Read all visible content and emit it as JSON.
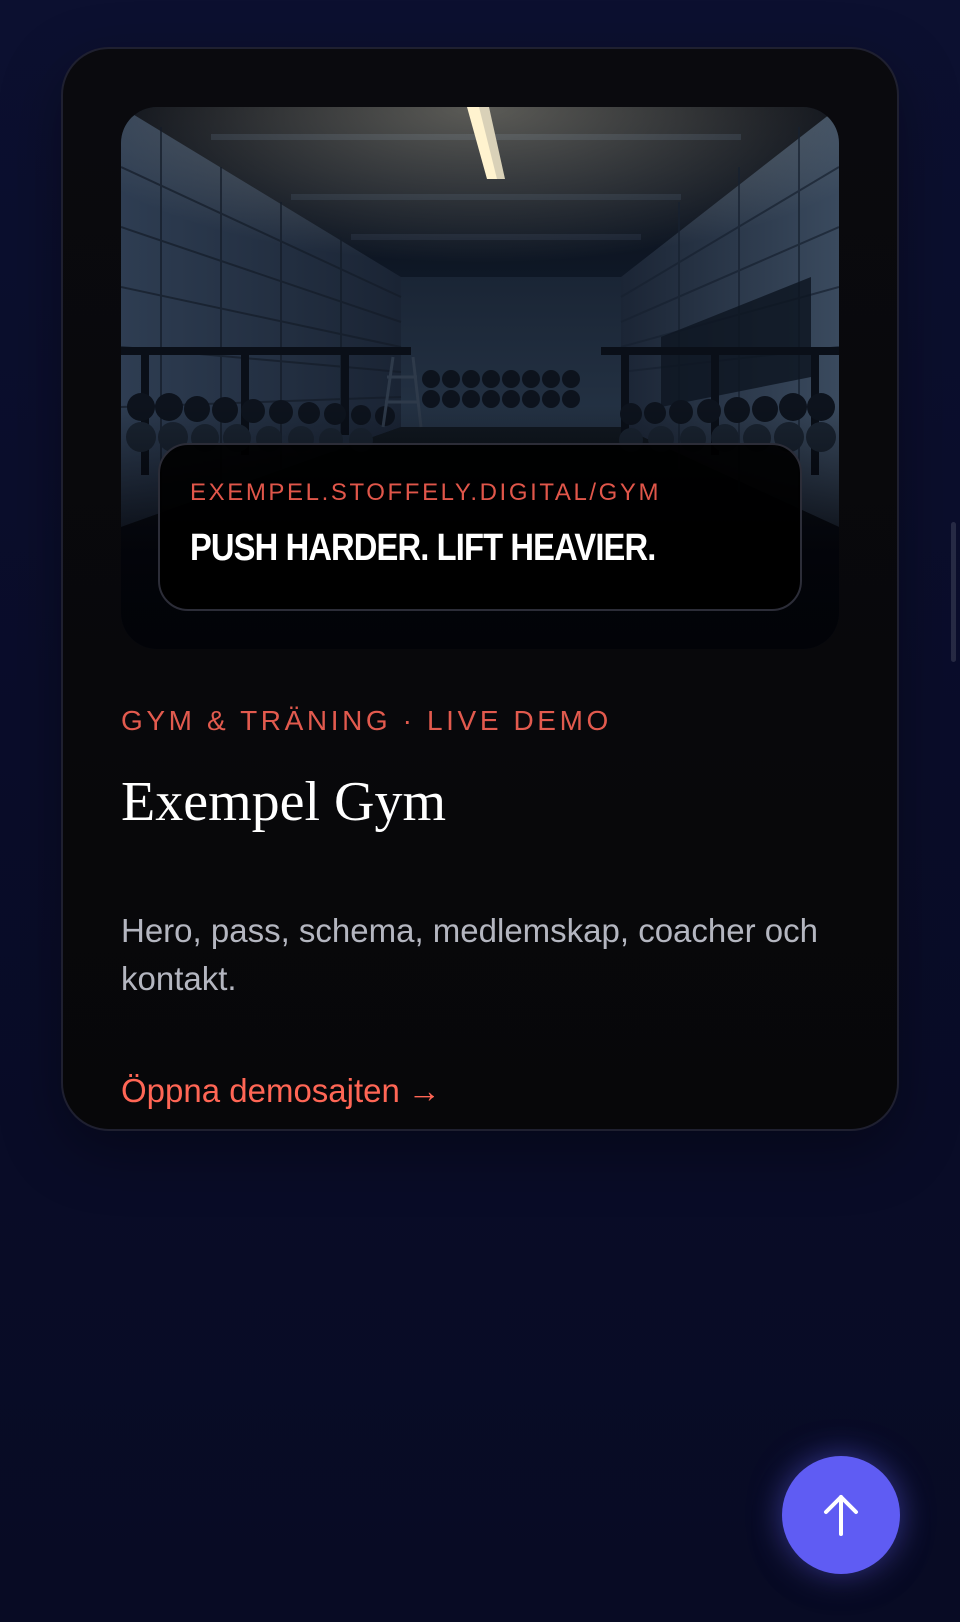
{
  "demo_card": {
    "preview": {
      "image": "dark-gym-interior-photo",
      "url_label": "EXEMPEL.STOFFELY.DIGITAL/GYM",
      "slogan": "PUSH HARDER. LIFT HEAVIER."
    },
    "meta": "GYM & TRÄNING · LIVE DEMO",
    "title": "Exempel Gym",
    "description": "Hero, pass, schema, medlemskap, coacher och kontakt.",
    "link_label": "Öppna demosajten",
    "link_arrow": "→"
  },
  "scroll_top": {
    "icon": "arrow-up-icon"
  },
  "colors": {
    "background": "#0a0d2a",
    "card": "#08080b",
    "accent_red": "#e25a4e",
    "link_red": "#ff6655",
    "button_purple": "#5f5cf3"
  }
}
